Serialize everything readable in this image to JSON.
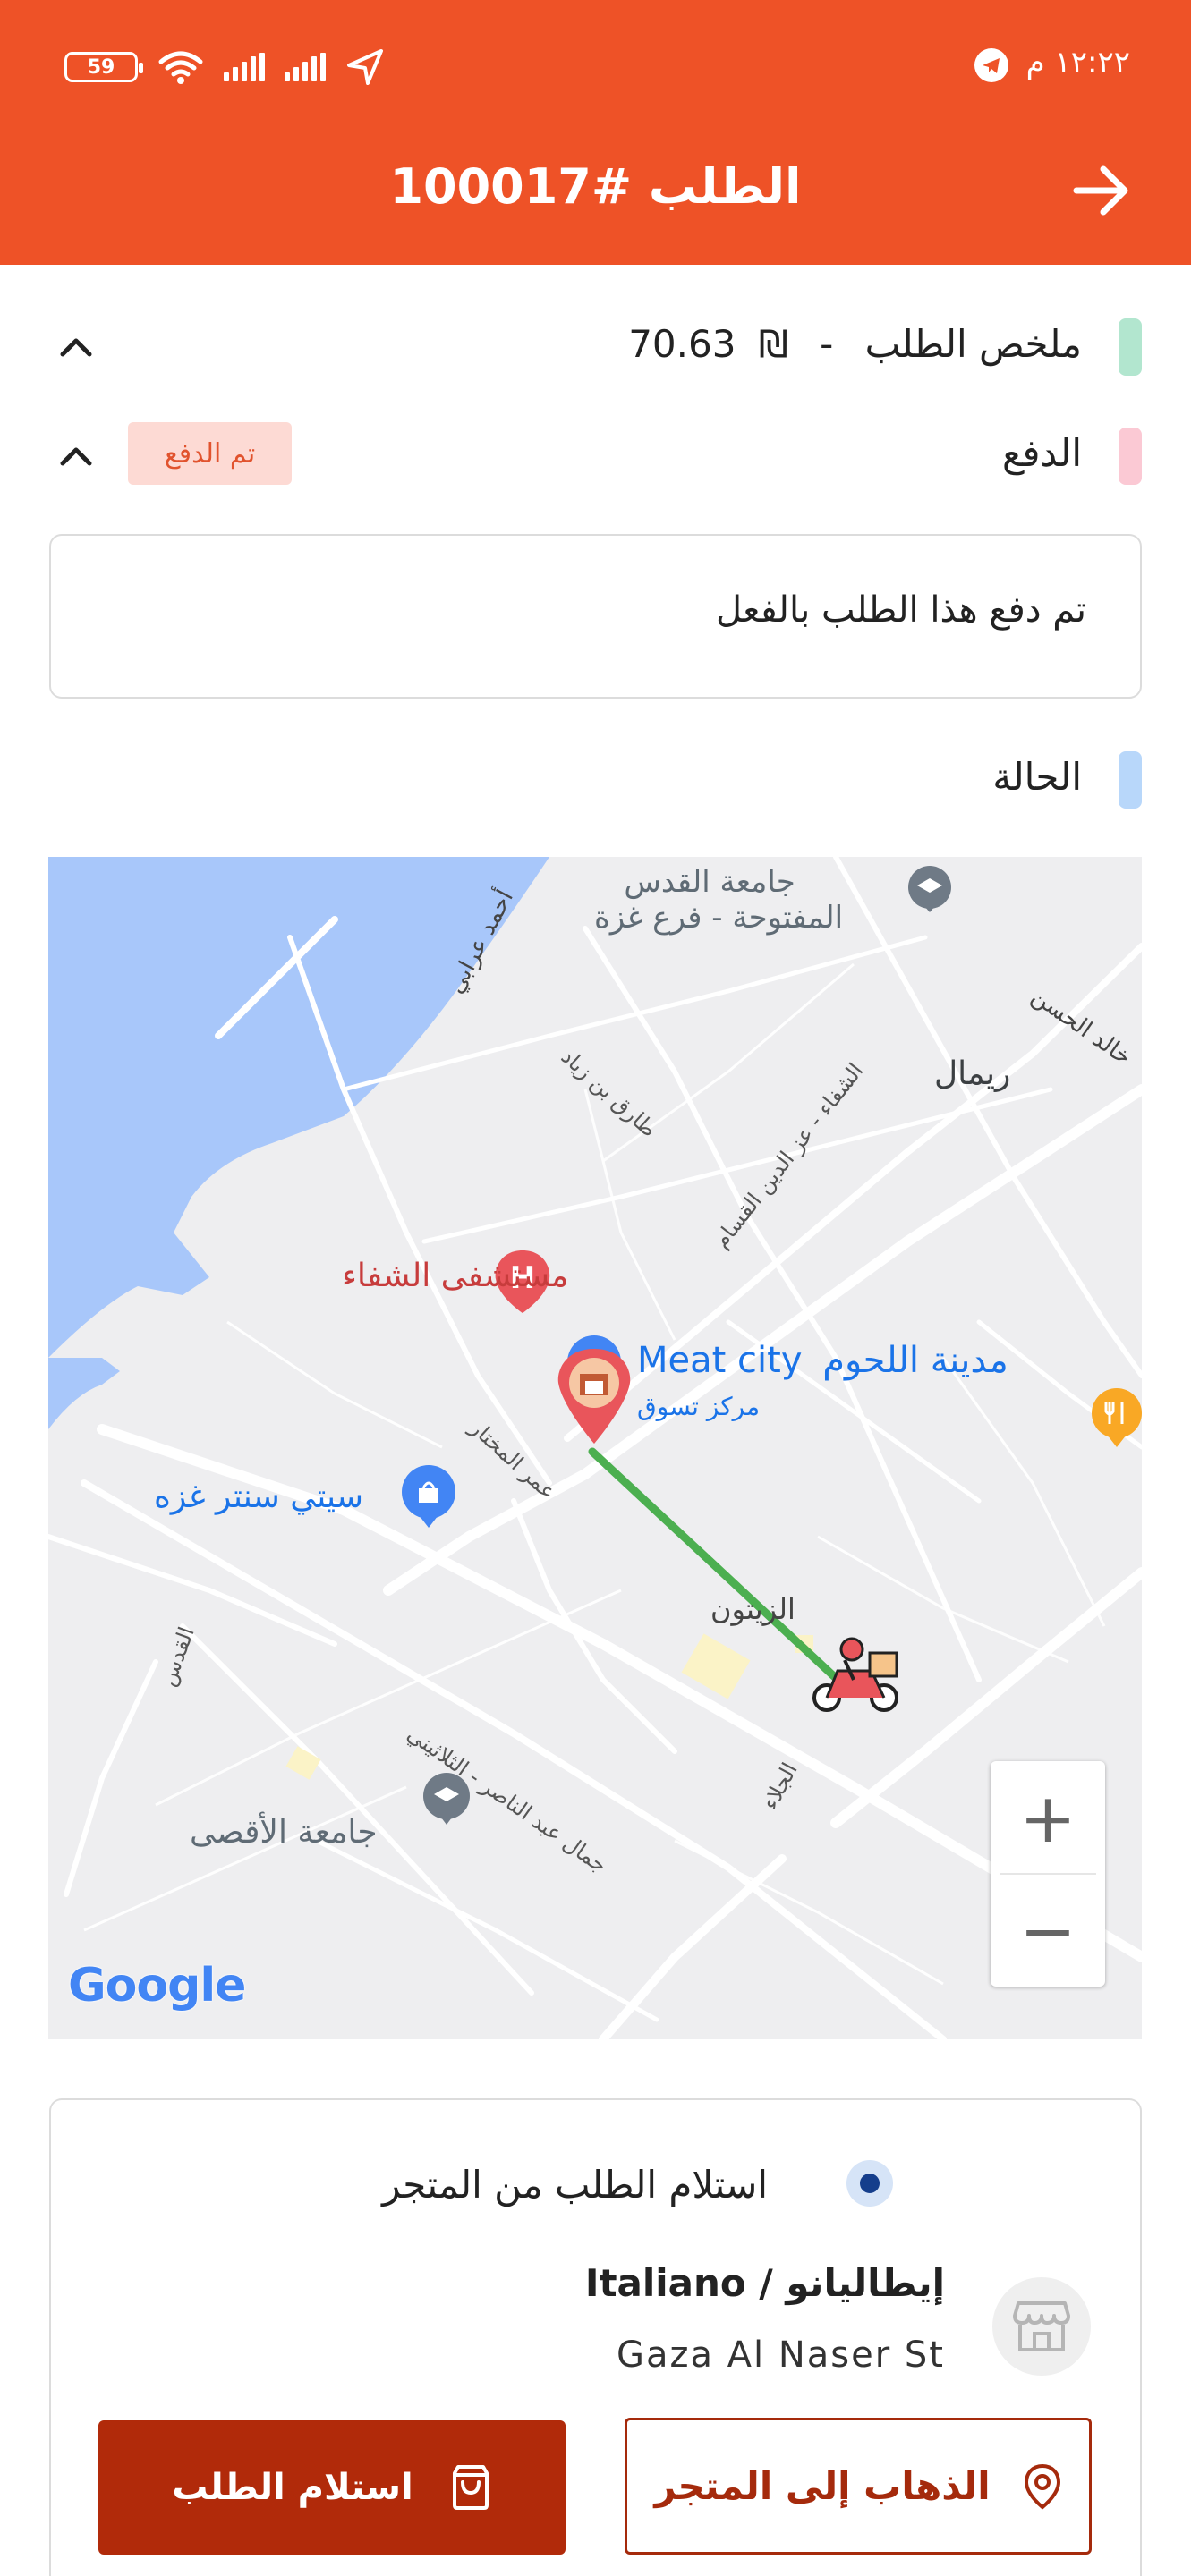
{
  "status_bar": {
    "time": "١٢:٢٢ م",
    "battery": "59"
  },
  "header": {
    "title": "الطلب #100017"
  },
  "summary": {
    "label": "ملخص الطلب",
    "separator": "-",
    "currency": "₪",
    "amount": "70.63"
  },
  "payment": {
    "label": "الدفع",
    "badge": "تم الدفع",
    "message": "تم دفع هذا الطلب بالفعل"
  },
  "status": {
    "label": "الحالة"
  },
  "map": {
    "labels": {
      "quds_univ_1": "جامعة القدس",
      "quds_univ_2": "المفتوحة - فرع غزة",
      "rimal": "ريمال",
      "khaled": "خالد الحسن",
      "ahmad": "أحمد عرابي",
      "tareq": "طارق بن زياد",
      "shifa_road": "الشفاء - عز الدين القسام",
      "shifa_hospital": "مستشفى الشفاء",
      "meat_ar": "مدينة اللحوم",
      "meat_en": "Meat city",
      "mall": "مركز تسوق",
      "city_center": "سيتي سنتر غزه",
      "omar": "عمر المختار",
      "zaitoun": "الزيتون",
      "quds_st": "القدس",
      "jamal_1": "جمال عبد الناصر - الثلاثيني",
      "jalaa": "الجلاء",
      "aqsa": "جامعة الأقصى",
      "google": "Google"
    },
    "zoom_in": "+",
    "zoom_out": "−",
    "colors": {
      "water": "#A8C7FA",
      "route": "#4CAF50",
      "hospital": "#E9555B",
      "marker": "#4285F4"
    }
  },
  "pickup": {
    "option_label": "استلام الطلب من المتجر",
    "store_name": "إيطاليانو / Italiano",
    "store_address": "Gaza Al Naser St",
    "directions_button": "الذهاب إلى المتجر",
    "pickup_button": "استلام الطلب"
  },
  "colors": {
    "header": "#EE5227",
    "summary_marker": "#B2E6CF",
    "payment_marker": "#FBC9D4",
    "status_marker": "#B8D7FA",
    "primary_button": "#B12A0A"
  }
}
